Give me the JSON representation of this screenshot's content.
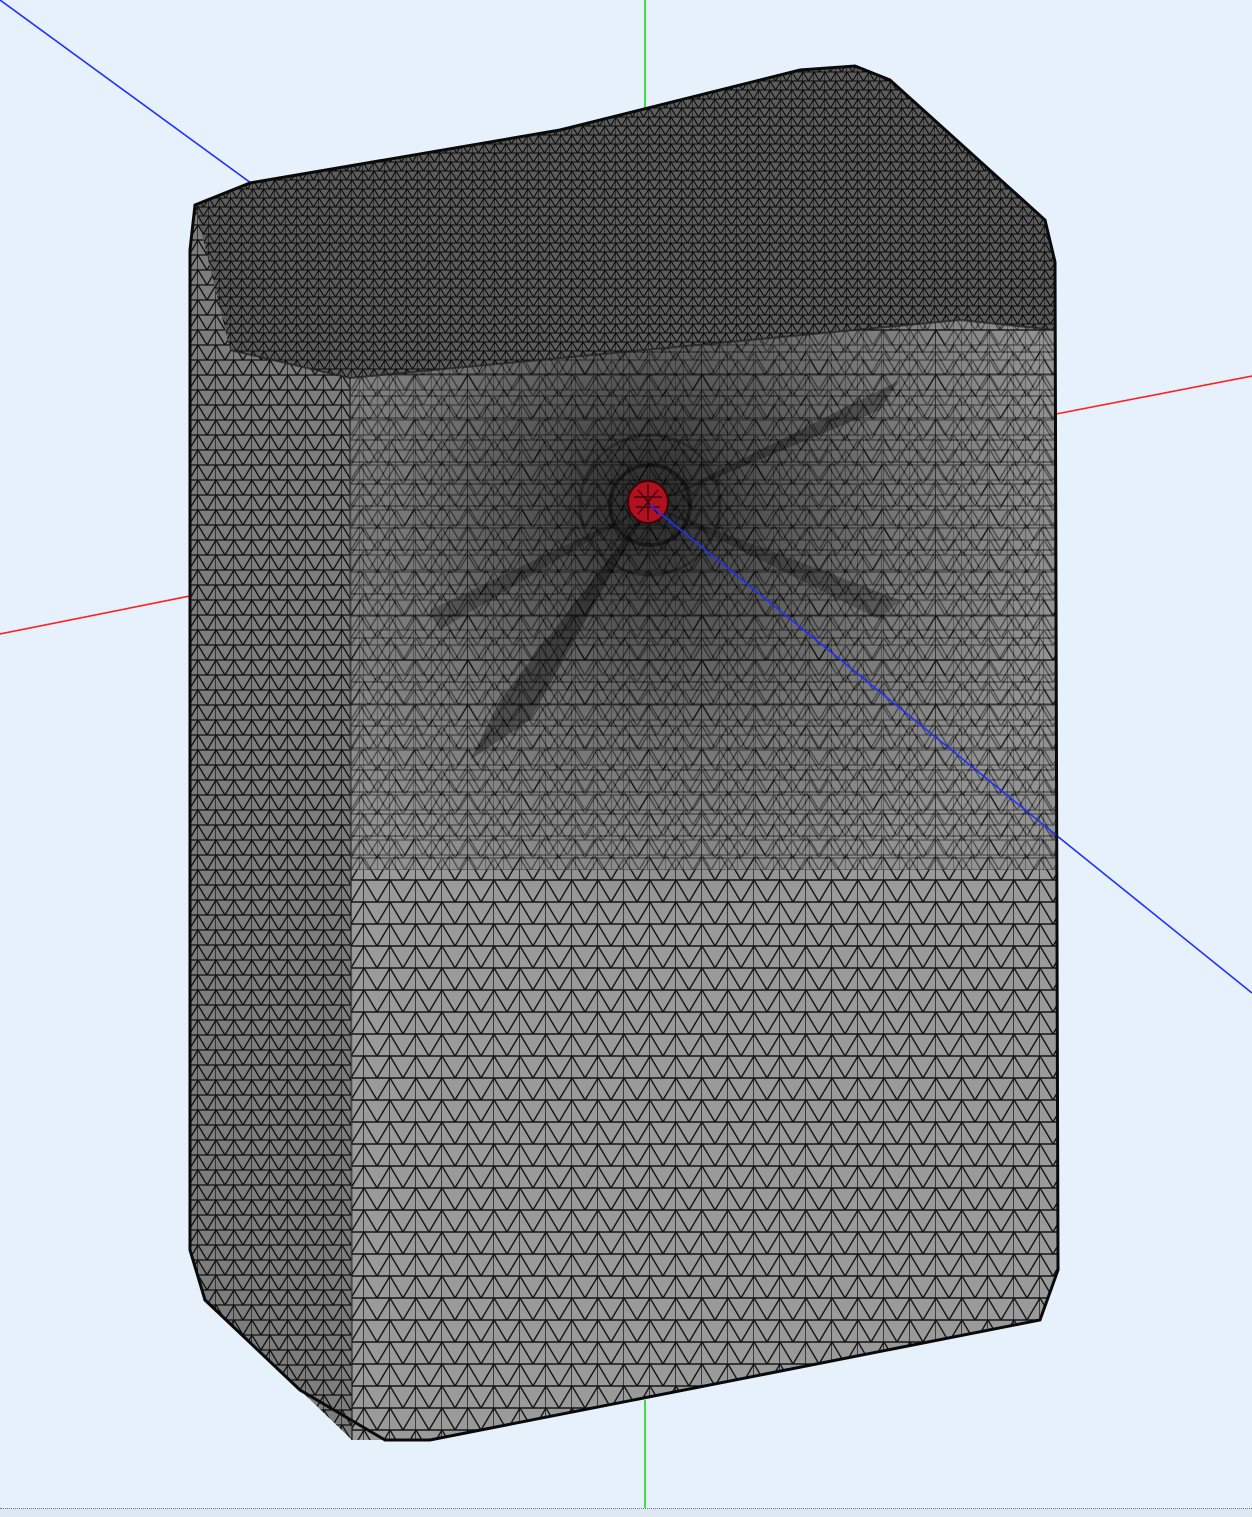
{
  "viewport": {
    "background_color": "#e6f1fc",
    "axes": {
      "x_axis_color": "#ff2020",
      "y_axis_color": "#10dd10",
      "z_axis_color": "#2030ff"
    },
    "model": {
      "kind": "tetrahedral-surface-mesh",
      "face_color": "#999999",
      "edge_color": "#111111",
      "highlight_color": "#b01020"
    }
  }
}
